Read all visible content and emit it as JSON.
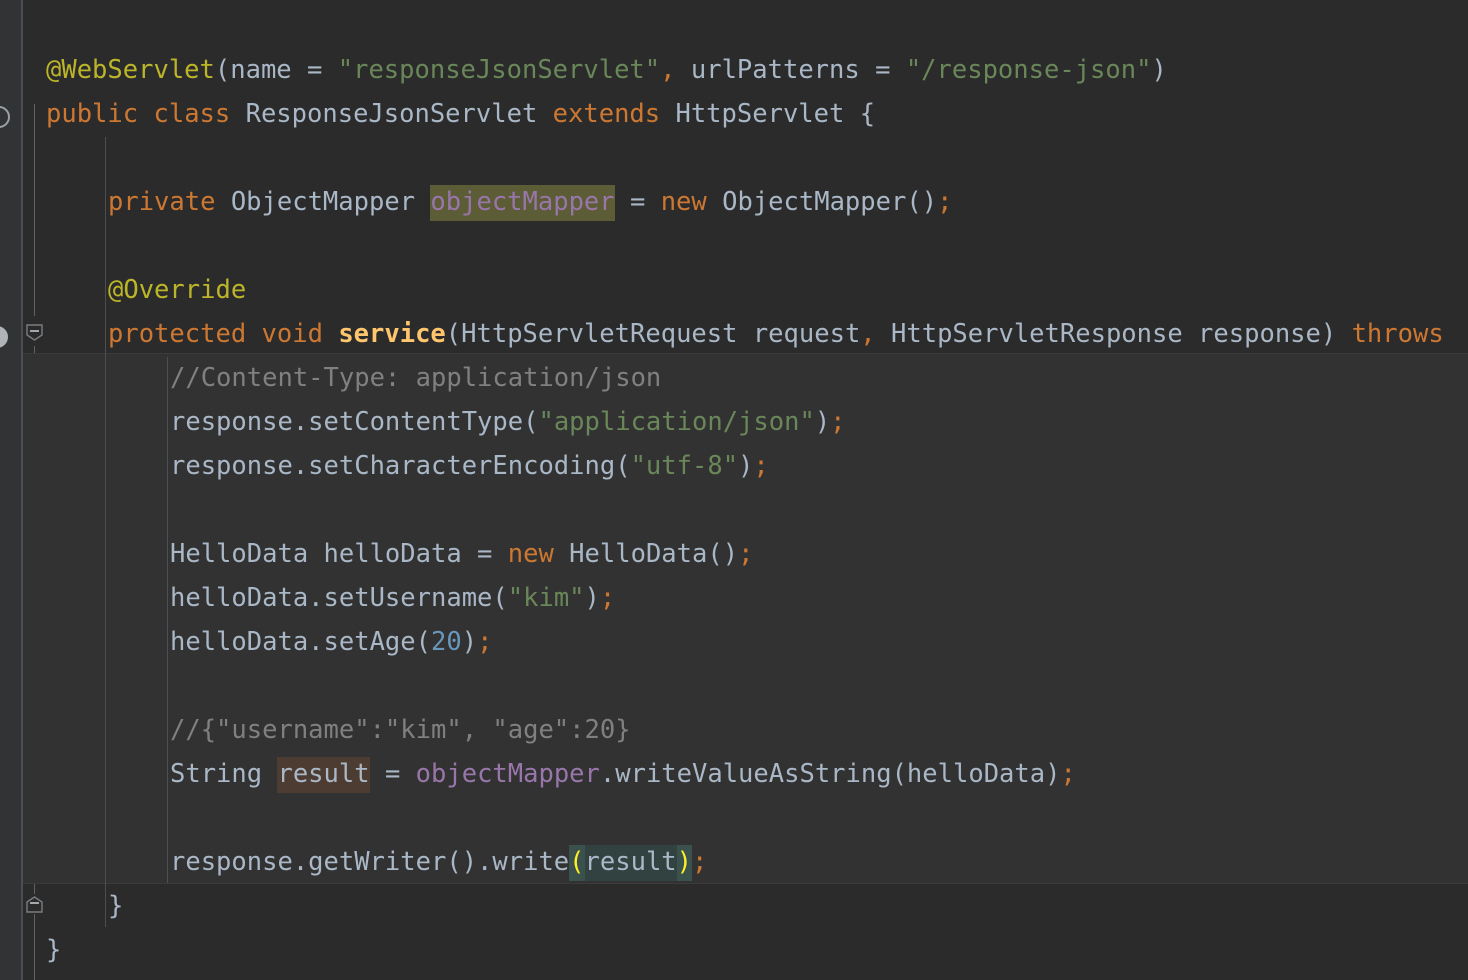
{
  "editor": {
    "theme": "darcula",
    "language": "java",
    "colors": {
      "background": "#2b2b2b",
      "gutter": "#313335",
      "gutter_separator": "#4b4f52",
      "default_text": "#a9b7c6",
      "keyword": "#cc7832",
      "annotation": "#bbb529",
      "string": "#6a8759",
      "number": "#6897bb",
      "comment": "#808080",
      "field": "#9876aa",
      "method_declaration": "#ffc66d",
      "matched_brace": "#ffef28",
      "identifier_usage_highlight": "#5c5c36",
      "identifier_write_highlight": "#4d3c31",
      "matched_brace_highlight": "#3b514d",
      "code_block_band": "#323232",
      "indent_guide": "#4b4f52"
    },
    "gutter_markers": [
      {
        "name": "class-run-marker",
        "kind": "run-gutter-icon",
        "line": 2
      },
      {
        "name": "method-override-marker",
        "kind": "overriding-method-icon",
        "line": 8
      },
      {
        "name": "method-fold-handle",
        "kind": "fold-collapse",
        "line": 8
      },
      {
        "name": "class-fold-handle",
        "kind": "fold-collapse",
        "line": 21
      }
    ],
    "lines": [
      {
        "n": 1,
        "indent": 0,
        "tokens": [
          {
            "t": "@WebServlet",
            "c": "anno"
          },
          {
            "t": "(",
            "c": "ident"
          },
          {
            "t": "name",
            "c": "ident"
          },
          {
            "t": " = ",
            "c": "ident"
          },
          {
            "t": "\"responseJsonServlet\"",
            "c": "str"
          },
          {
            "t": ", ",
            "c": "semi"
          },
          {
            "t": "urlPatterns",
            "c": "ident"
          },
          {
            "t": " = ",
            "c": "ident"
          },
          {
            "t": "\"/response-json\"",
            "c": "str"
          },
          {
            "t": ")",
            "c": "ident"
          }
        ]
      },
      {
        "n": 2,
        "indent": 0,
        "tokens": [
          {
            "t": "public",
            "c": "kw"
          },
          {
            "t": " ",
            "c": "ident"
          },
          {
            "t": "class",
            "c": "kw"
          },
          {
            "t": " ResponseJsonServlet ",
            "c": "ident"
          },
          {
            "t": "extends",
            "c": "kw"
          },
          {
            "t": " HttpServlet {",
            "c": "ident"
          }
        ]
      },
      {
        "n": 3,
        "indent": 0,
        "tokens": []
      },
      {
        "n": 4,
        "indent": 1,
        "tokens": [
          {
            "t": "private",
            "c": "kw"
          },
          {
            "t": " ObjectMapper ",
            "c": "ident"
          },
          {
            "t": "objectMapper",
            "c": "field",
            "hl": "usage"
          },
          {
            "t": " = ",
            "c": "ident"
          },
          {
            "t": "new",
            "c": "kw"
          },
          {
            "t": " ObjectMapper()",
            "c": "ident"
          },
          {
            "t": ";",
            "c": "semi"
          }
        ]
      },
      {
        "n": 5,
        "indent": 1,
        "tokens": []
      },
      {
        "n": 6,
        "indent": 1,
        "tokens": [
          {
            "t": "@Override",
            "c": "anno"
          }
        ]
      },
      {
        "n": 7,
        "indent": 1,
        "tokens": [
          {
            "t": "protected",
            "c": "kw"
          },
          {
            "t": " ",
            "c": "ident"
          },
          {
            "t": "void",
            "c": "kw"
          },
          {
            "t": " ",
            "c": "ident"
          },
          {
            "t": "service",
            "c": "method"
          },
          {
            "t": "(HttpServletRequest request",
            "c": "ident"
          },
          {
            "t": ",",
            "c": "semi"
          },
          {
            "t": " HttpServletResponse response) ",
            "c": "ident"
          },
          {
            "t": "throws",
            "c": "kw"
          }
        ],
        "clipped_right": true
      },
      {
        "n": 8,
        "indent": 2,
        "tokens": [
          {
            "t": "//Content-Type: application/json",
            "c": "cmt"
          }
        ]
      },
      {
        "n": 9,
        "indent": 2,
        "tokens": [
          {
            "t": "response.setContentType(",
            "c": "ident"
          },
          {
            "t": "\"application/json\"",
            "c": "str"
          },
          {
            "t": ")",
            "c": "ident"
          },
          {
            "t": ";",
            "c": "semi"
          }
        ]
      },
      {
        "n": 10,
        "indent": 2,
        "tokens": [
          {
            "t": "response.setCharacterEncoding(",
            "c": "ident"
          },
          {
            "t": "\"utf-8\"",
            "c": "str"
          },
          {
            "t": ")",
            "c": "ident"
          },
          {
            "t": ";",
            "c": "semi"
          }
        ]
      },
      {
        "n": 11,
        "indent": 2,
        "tokens": []
      },
      {
        "n": 12,
        "indent": 2,
        "tokens": [
          {
            "t": "HelloData helloData = ",
            "c": "ident"
          },
          {
            "t": "new",
            "c": "kw"
          },
          {
            "t": " HelloData()",
            "c": "ident"
          },
          {
            "t": ";",
            "c": "semi"
          }
        ]
      },
      {
        "n": 13,
        "indent": 2,
        "tokens": [
          {
            "t": "helloData.setUsername(",
            "c": "ident"
          },
          {
            "t": "\"kim\"",
            "c": "str"
          },
          {
            "t": ")",
            "c": "ident"
          },
          {
            "t": ";",
            "c": "semi"
          }
        ]
      },
      {
        "n": 14,
        "indent": 2,
        "tokens": [
          {
            "t": "helloData.setAge(",
            "c": "ident"
          },
          {
            "t": "20",
            "c": "num"
          },
          {
            "t": ")",
            "c": "ident"
          },
          {
            "t": ";",
            "c": "semi"
          }
        ]
      },
      {
        "n": 15,
        "indent": 2,
        "tokens": []
      },
      {
        "n": 16,
        "indent": 2,
        "tokens": [
          {
            "t": "//{\"username\":\"kim\", \"age\":20}",
            "c": "cmt"
          }
        ]
      },
      {
        "n": 17,
        "indent": 2,
        "tokens": [
          {
            "t": "String ",
            "c": "ident"
          },
          {
            "t": "result",
            "c": "ident",
            "hl": "write"
          },
          {
            "t": " = ",
            "c": "ident"
          },
          {
            "t": "objectMapper",
            "c": "field"
          },
          {
            "t": ".writeValueAsString(helloData)",
            "c": "ident"
          },
          {
            "t": ";",
            "c": "semi"
          }
        ]
      },
      {
        "n": 18,
        "indent": 2,
        "tokens": []
      },
      {
        "n": 19,
        "indent": 2,
        "tokens": [
          {
            "t": "response.getWriter().write",
            "c": "ident"
          },
          {
            "t": "(",
            "c": "brace-hl",
            "hl": "brace"
          },
          {
            "t": "result",
            "c": "ident",
            "hl": "braceinner"
          },
          {
            "t": ")",
            "c": "brace-hl",
            "hl": "brace"
          },
          {
            "t": ";",
            "c": "semi"
          }
        ]
      },
      {
        "n": 20,
        "indent": 1,
        "tokens": [
          {
            "t": "}",
            "c": "ident"
          }
        ]
      },
      {
        "n": 21,
        "indent": 0,
        "tokens": [
          {
            "t": "}",
            "c": "ident"
          }
        ]
      }
    ]
  }
}
